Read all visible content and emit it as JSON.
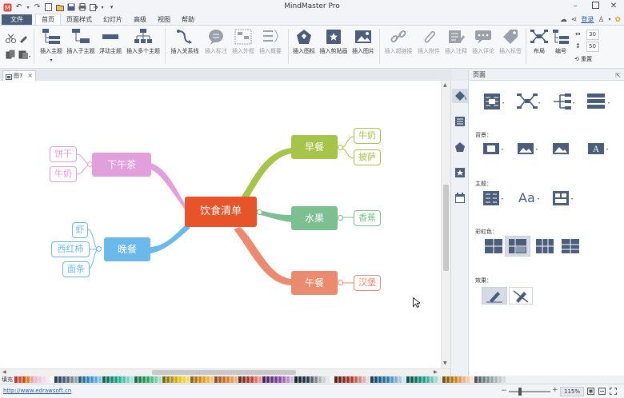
{
  "app": {
    "title": "MindMaster Pro"
  },
  "menu": {
    "file": "文件",
    "items": [
      "首页",
      "页面样式",
      "幻灯片",
      "高级",
      "视图",
      "帮助"
    ],
    "active_index": 0,
    "login": "登录"
  },
  "ribbon": {
    "group1": [
      "插入主题",
      "插入子主题",
      "浮动主题",
      "插入多个主题"
    ],
    "group2": [
      "插入关系线",
      "插入标注",
      "插入外框",
      "插入概要"
    ],
    "group3": [
      "插入图标",
      "插入剪贴画",
      "插入图片"
    ],
    "group4": [
      "插入超链接",
      "插入附件",
      "插入注释",
      "插入评论",
      "插入标签"
    ],
    "group5": [
      "布局",
      "编号"
    ],
    "reset": "重置",
    "spin1": "30",
    "spin2": "50"
  },
  "document": {
    "tab_name": "图7"
  },
  "mindmap": {
    "root": "饮食清单",
    "branches": [
      {
        "label": "早餐",
        "color": "#a6c449",
        "children": [
          "牛奶",
          "披萨"
        ]
      },
      {
        "label": "水果",
        "color": "#7cbf91",
        "children": [
          "香蕉"
        ]
      },
      {
        "label": "午餐",
        "color": "#ea8a6e",
        "children": [
          "汉堡"
        ]
      },
      {
        "label": "下午茶",
        "color": "#e19fdb",
        "children": [
          "饼干",
          "牛奶"
        ]
      },
      {
        "label": "晚餐",
        "color": "#6bb8ea",
        "children": [
          "虾",
          "西红柿",
          "面条"
        ]
      }
    ],
    "root_color": "#e8542a"
  },
  "panel": {
    "title": "页面",
    "background_label": "背景：",
    "theme_label": "主题：",
    "rainbow_label": "彩虹色：",
    "effect_label": "效果："
  },
  "palette": {
    "label": "填充"
  },
  "status": {
    "url": "http://www.edrawsoft.cn",
    "zoom": "115%"
  }
}
